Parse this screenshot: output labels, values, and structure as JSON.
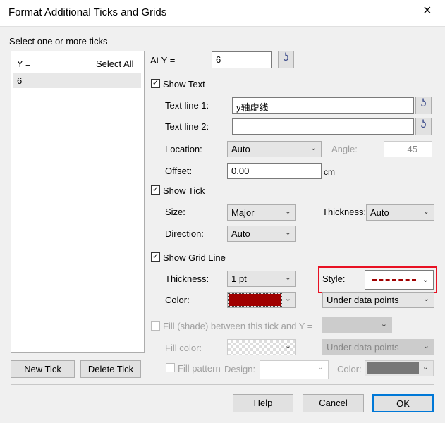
{
  "title": "Format Additional Ticks and Grids",
  "close_icon": "×",
  "select_ticks_label": "Select one or more ticks",
  "list": {
    "header": "Y =",
    "select_all": "Select All",
    "items": [
      "6"
    ]
  },
  "at_y": {
    "label": "At Y =",
    "value": "6"
  },
  "hook_icon": "ʖ",
  "show_text": {
    "label": "Show Text",
    "checked": true,
    "check": "✓"
  },
  "text_line1": {
    "label": "Text line 1:",
    "value": "y轴虚线"
  },
  "text_line2": {
    "label": "Text line 2:",
    "value": ""
  },
  "location": {
    "label": "Location:",
    "value": "Auto"
  },
  "angle": {
    "label": "Angle:",
    "value": "45"
  },
  "offset": {
    "label": "Offset:",
    "value": "0.00",
    "unit": "cm"
  },
  "show_tick": {
    "label": "Show Tick",
    "checked": true
  },
  "size": {
    "label": "Size:",
    "value": "Major"
  },
  "tick_thickness": {
    "label": "Thickness:",
    "value": "Auto"
  },
  "direction": {
    "label": "Direction:",
    "value": "Auto"
  },
  "show_grid": {
    "label": "Show Grid Line",
    "checked": true
  },
  "grid_thickness": {
    "label": "Thickness:",
    "value": "1 pt"
  },
  "style": {
    "label": "Style:",
    "value": "dashed"
  },
  "color": {
    "label": "Color:",
    "value": "#a00000"
  },
  "grid_layer": {
    "value": "Under data points"
  },
  "fill_shade": {
    "label": "Fill (shade) between this tick and Y =",
    "checked": false
  },
  "fill_color": {
    "label": "Fill color:"
  },
  "fill_layer": {
    "value": "Under data points"
  },
  "fill_pattern": {
    "label": "Fill pattern",
    "checked": false
  },
  "design": {
    "label": "Design:"
  },
  "pattern_color": {
    "label": "Color:"
  },
  "buttons": {
    "new_tick": "New Tick",
    "delete_tick": "Delete Tick",
    "help": "Help",
    "cancel": "Cancel",
    "ok": "OK"
  },
  "chevron": "⌄",
  "highlight_color": "#e81123"
}
